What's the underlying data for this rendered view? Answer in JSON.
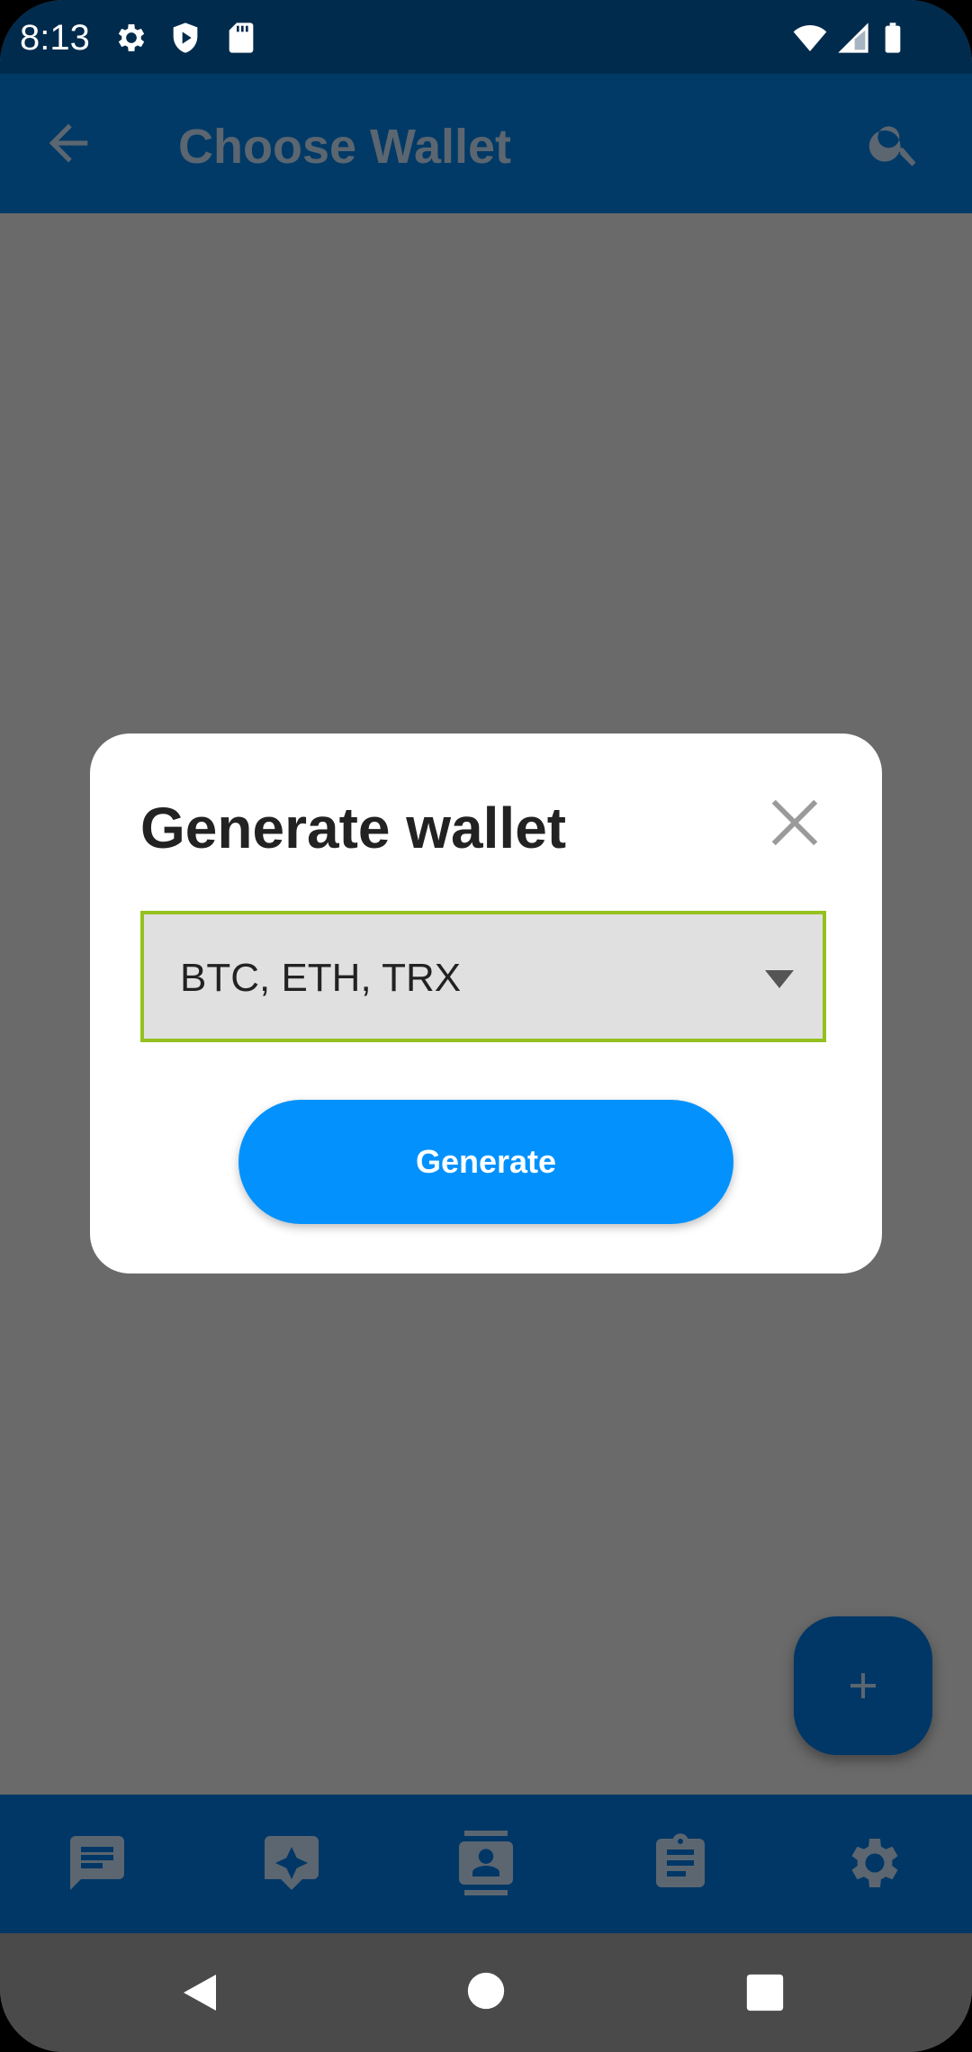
{
  "status_bar": {
    "time": "8:13",
    "icons": [
      "settings-icon",
      "shield-icon",
      "sd-card-icon",
      "wifi-icon",
      "signal-icon",
      "battery-icon"
    ]
  },
  "app_bar": {
    "title": "Choose Wallet",
    "back_icon": "arrow-back-icon",
    "search_icon": "search-icon"
  },
  "dialog": {
    "title": "Generate wallet",
    "close_icon": "close-icon",
    "select_value": "BTC, ETH, TRX",
    "generate_label": "Generate"
  },
  "fab": {
    "icon": "plus-icon"
  },
  "bottom_nav": {
    "items": [
      "chat-icon",
      "sparkle-chat-icon",
      "contacts-icon",
      "clipboard-icon",
      "settings-icon"
    ]
  },
  "system_nav": {
    "icons": [
      "back-triangle-icon",
      "home-circle-icon",
      "recents-square-icon"
    ]
  },
  "colors": {
    "status_bar": "#012b4d",
    "app_bar": "#013a67",
    "overlay": "#6a6a6a",
    "accent": "#0392fd",
    "select_border": "#95c11f"
  }
}
